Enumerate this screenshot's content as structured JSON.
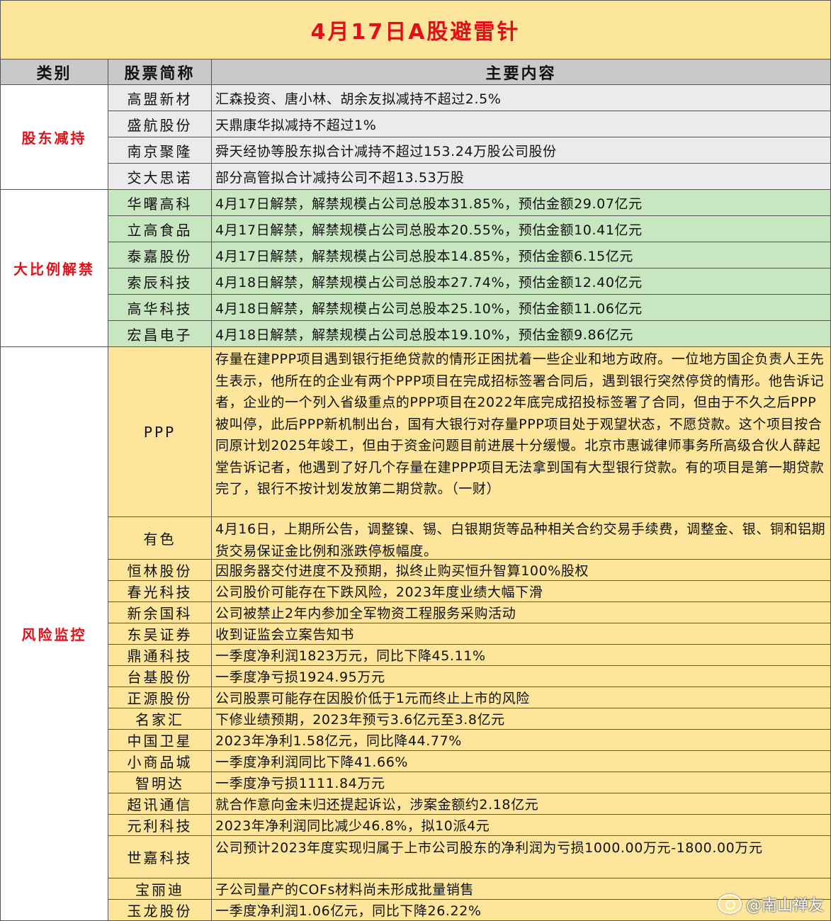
{
  "title": "4月17日A股避雷针",
  "headers": {
    "category": "类别",
    "stock": "股票简称",
    "content": "主要内容"
  },
  "colors": {
    "title_bg": "#fbe59a",
    "title_text": "#e0101a",
    "header_bg": "#c9c9c9",
    "category_text": "#e0101a",
    "group_reduce_bg": "#ebebeb",
    "group_unlock_bg": "#c8e6c0",
    "group_risk_bg": "#fde59b"
  },
  "groups": [
    {
      "category": "股东减持",
      "rows": [
        {
          "name": "高盟新材",
          "content": "汇森投资、唐小林、胡余友拟减持不超过2.5%"
        },
        {
          "name": "盛航股份",
          "content": "天鼎康华拟减持不超过1%"
        },
        {
          "name": "南京聚隆",
          "content": "舜天经协等股东拟合计减持不超过153.24万股公司股份"
        },
        {
          "name": "交大思诺",
          "content": "部分高管拟合计减持公司不超13.53万股"
        }
      ]
    },
    {
      "category": "大比例解禁",
      "rows": [
        {
          "name": "华曙高科",
          "content": "4月17日解禁，解禁规模占公司总股本31.85%，预估金额29.07亿元"
        },
        {
          "name": "立高食品",
          "content": "4月17日解禁，解禁规模占公司总股本20.55%，预估金额10.41亿元"
        },
        {
          "name": "泰嘉股份",
          "content": "4月17日解禁，解禁规模占公司总股本14.85%，预估金额6.15亿元"
        },
        {
          "name": "索辰科技",
          "content": "4月18日解禁，解禁规模占公司总股本27.74%，预估金额12.40亿元"
        },
        {
          "name": "高华科技",
          "content": "4月18日解禁，解禁规模占公司总股本25.10%，预估金额11.06亿元"
        },
        {
          "name": "宏昌电子",
          "content": "4月18日解禁，解禁规模占公司总股本19.10%，预估金额9.86亿元"
        }
      ]
    },
    {
      "category": "风险监控",
      "rows": [
        {
          "name": "PPP",
          "content": "存量在建PPP项目遇到银行拒绝贷款的情形正困扰着一些企业和地方政府。一位地方国企负责人王先生表示，他所在的企业有两个PPP项目在完成招标签署合同后，遇到银行突然停贷的情形。他告诉记者，企业的一个列入省级重点的PPP项目在2022年底完成招投标签署了合同，但由于不久之后PPP被叫停，此后PPP新机制出台，国有大银行对存量PPP项目处于观望状态，不愿贷款。这个项目按合同原计划2025年竣工，但由于资金问题目前进展十分缓慢。北京市惠诚律师事务所高级合伙人薛起堂告诉记者，他遇到了好几个存量在建PPP项目无法拿到国有大型银行贷款。有的项目是第一期贷款完了，银行不按计划发放第二期贷款。（一财）"
        },
        {
          "name": "有色",
          "content": "4月16日，上期所公告，调整镍、锡、白银期货等品种相关合约交易手续费，调整金、银、铜和铝期货交易保证金比例和涨跌停板幅度。"
        },
        {
          "name": "恒林股份",
          "content": "因服务器交付进度不及预期，拟终止购买恒升智算100%股权"
        },
        {
          "name": "春光科技",
          "content": "公司股价可能存在下跌风险，2023年度业绩大幅下滑"
        },
        {
          "name": "新余国科",
          "content": "公司被禁止2年内参加全军物资工程服务采购活动"
        },
        {
          "name": "东吴证券",
          "content": "收到证监会立案告知书"
        },
        {
          "name": "鼎通科技",
          "content": "一季度净利润1823万元，同比下降45.11%"
        },
        {
          "name": "台基股份",
          "content": "一季度净亏损1924.95万元"
        },
        {
          "name": "正源股份",
          "content": "公司股票可能存在因股价低于1元而终止上市的风险"
        },
        {
          "name": "名家汇",
          "content": "下修业绩预期，2023年预亏3.6亿元至3.8亿元"
        },
        {
          "name": "中国卫星",
          "content": "2023年净利1.58亿元，同比降44.77%"
        },
        {
          "name": "小商品城",
          "content": "一季度净利润同比下降41.66%"
        },
        {
          "name": "智明达",
          "content": "一季度净亏损1111.84万元"
        },
        {
          "name": "超讯通信",
          "content": "就合作意向金未归还提起诉讼，涉案金额约2.18亿元"
        },
        {
          "name": "元利科技",
          "content": "2023年净利润同比减少46.8%，拟10派4元"
        },
        {
          "name": "世嘉科技",
          "content": "公司预计2023年度实现归属于上市公司股东的净利润为亏损1000.00万元-1800.00万元"
        },
        {
          "name": "宝丽迪",
          "content": "子公司量产的COFs材料尚未形成批量销售"
        },
        {
          "name": "玉龙股份",
          "content": "一季度净利润1.06亿元，同比下降26.22%"
        }
      ]
    }
  ],
  "watermark": {
    "icon": "weibo-icon",
    "text": "@南山禅友"
  }
}
